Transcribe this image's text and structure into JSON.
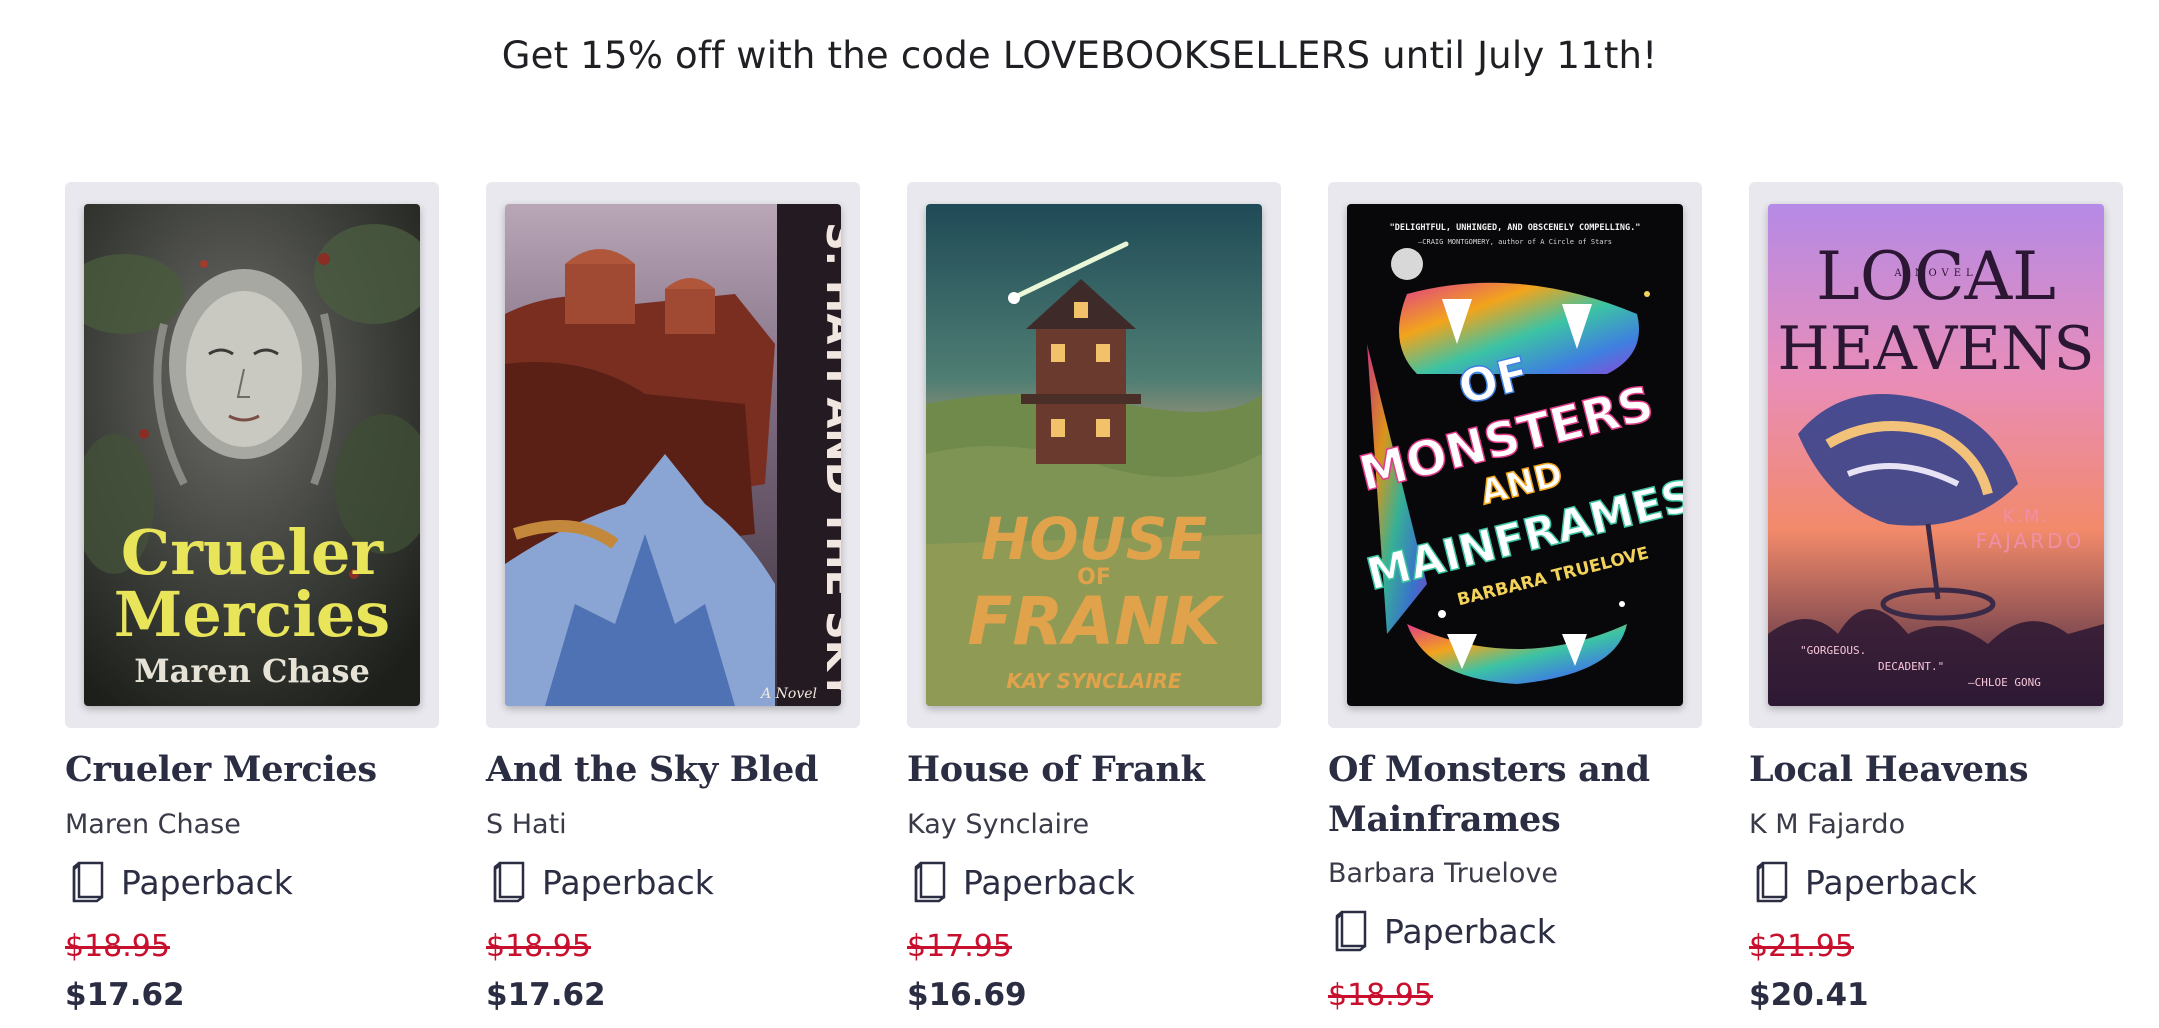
{
  "promo": {
    "text": "Get 15% off with the code LOVEBOOKSELLERS until July 11th!"
  },
  "books": [
    {
      "title": "Crueler Mercies",
      "author": "Maren Chase",
      "format": "Paperback",
      "list_price": "$18.95",
      "sale_price": "$17.62",
      "cover_text": [
        "Crueler",
        "Mercies",
        "Maren Chase"
      ]
    },
    {
      "title": "And the Sky Bled",
      "author": "S Hati",
      "format": "Paperback",
      "list_price": "$18.95",
      "sale_price": "$17.62",
      "cover_text": [
        "S. HATI AND THE SKY BLED",
        "A Novel"
      ]
    },
    {
      "title": "House of Frank",
      "author": "Kay Synclaire",
      "format": "Paperback",
      "list_price": "$17.95",
      "sale_price": "$16.69",
      "cover_text": [
        "HOUSE",
        "OF",
        "FRANK",
        "KAY SYNCLAIRE"
      ]
    },
    {
      "title": "Of Monsters and Mainframes",
      "author": "Barbara Truelove",
      "format": "Paperback",
      "list_price": "$18.95",
      "sale_price": "",
      "cover_text": [
        "\"DELIGHTFUL, UNHINGED, AND OBSCENELY COMPELLING.\"",
        "—CRAIG MONTGOMERY, author of A Circle of Stars",
        "OF",
        "MONSTERS",
        "AND",
        "MAINFRAMES",
        "BARBARA TRUELOVE"
      ]
    },
    {
      "title": "Local Heavens",
      "author": "K M Fajardo",
      "format": "Paperback",
      "list_price": "$21.95",
      "sale_price": "$20.41",
      "cover_text": [
        "A NOVEL",
        "LOCAL",
        "HEAVENS",
        "K.M.",
        "FAJARDO",
        "\"GORGEOUS.",
        "DECADENT.\"",
        "—CHLOE GONG"
      ]
    }
  ]
}
